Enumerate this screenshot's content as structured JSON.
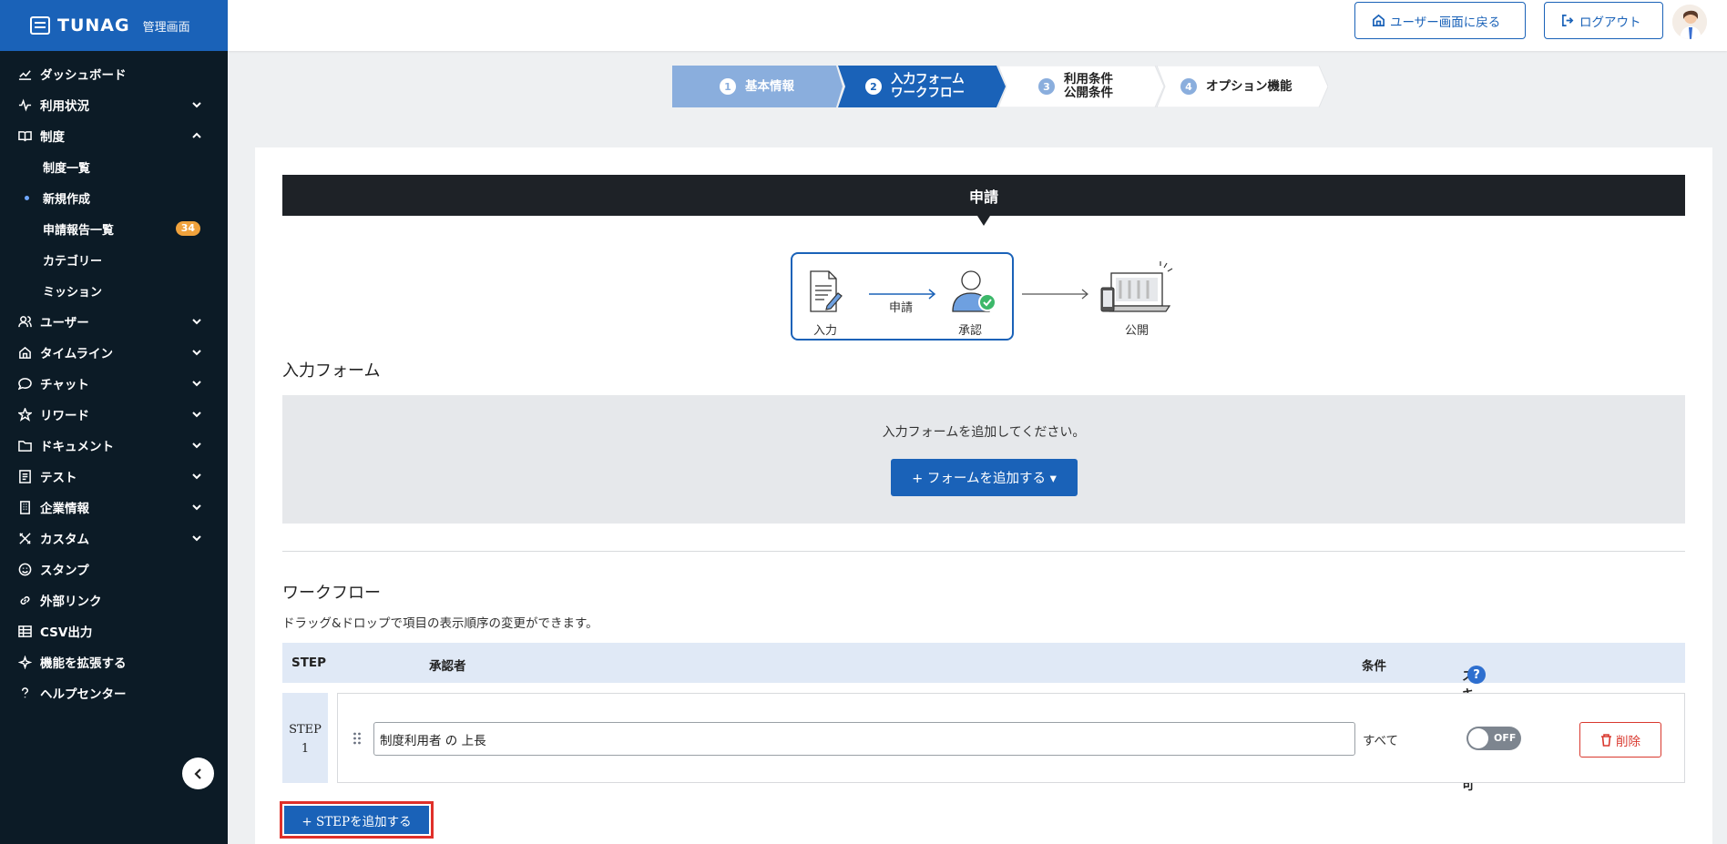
{
  "brand": {
    "name": "TUNAG",
    "sub": "管理画面"
  },
  "sidebar": {
    "items": [
      {
        "label": "ダッシュボード",
        "icon": "chart-icon"
      },
      {
        "label": "利用状況",
        "icon": "activity-icon"
      },
      {
        "label": "制度",
        "icon": "book-icon"
      },
      {
        "label": "ユーザー",
        "icon": "users-icon"
      },
      {
        "label": "タイムライン",
        "icon": "home-icon"
      },
      {
        "label": "チャット",
        "icon": "chat-icon"
      },
      {
        "label": "リワード",
        "icon": "star-icon"
      },
      {
        "label": "ドキュメント",
        "icon": "folder-icon"
      },
      {
        "label": "テスト",
        "icon": "test-icon"
      },
      {
        "label": "企業情報",
        "icon": "building-icon"
      },
      {
        "label": "カスタム",
        "icon": "custom-icon"
      },
      {
        "label": "スタンプ",
        "icon": "smile-icon"
      },
      {
        "label": "外部リンク",
        "icon": "link-icon"
      },
      {
        "label": "CSV出力",
        "icon": "table-icon"
      },
      {
        "label": "機能を拡張する",
        "icon": "sparkle-icon"
      },
      {
        "label": "ヘルプセンター",
        "icon": "help-icon"
      }
    ],
    "sub_items": [
      {
        "label": "制度一覧"
      },
      {
        "label": "新規作成"
      },
      {
        "label": "申請報告一覧",
        "badge": "34"
      },
      {
        "label": "カテゴリー"
      },
      {
        "label": "ミッション"
      }
    ]
  },
  "header": {
    "user_screen_label": "ユーザー画面に戻る",
    "logout_label": "ログアウト"
  },
  "steps": [
    {
      "num": "1",
      "label": "基本情報",
      "line2": ""
    },
    {
      "num": "2",
      "label": "入力フォーム",
      "line2": "ワークフロー"
    },
    {
      "num": "3",
      "label": "利用条件",
      "line2": "公開条件"
    },
    {
      "num": "4",
      "label": "オプション機能",
      "line2": ""
    }
  ],
  "request_bar": "申請",
  "flow": {
    "input": "入力",
    "request": "申請",
    "approve": "承認",
    "publish": "公開"
  },
  "input_form": {
    "title": "入力フォーム",
    "message": "入力フォームを追加してください。",
    "add_button": "+ フォームを追加する ▾"
  },
  "workflow": {
    "title": "ワークフロー",
    "description": "ドラッグ&ドロップで項目の表示順序の変更ができます。",
    "columns": {
      "step": "STEP",
      "approver": "承認者",
      "condition": "条件",
      "skip": "スキップの許可"
    },
    "rows": [
      {
        "step_line1": "STEP",
        "step_line2": "1",
        "approver": "制度利用者 の 上長",
        "condition": "すべて",
        "skip_state": "OFF",
        "delete": "削除"
      }
    ],
    "add_step": "+ STEPを追加する"
  },
  "colors": {
    "brand_blue": "#1a62b8",
    "sidebar_bg": "#0c1b26",
    "badge": "#f0a23c",
    "danger": "#d9382e"
  }
}
